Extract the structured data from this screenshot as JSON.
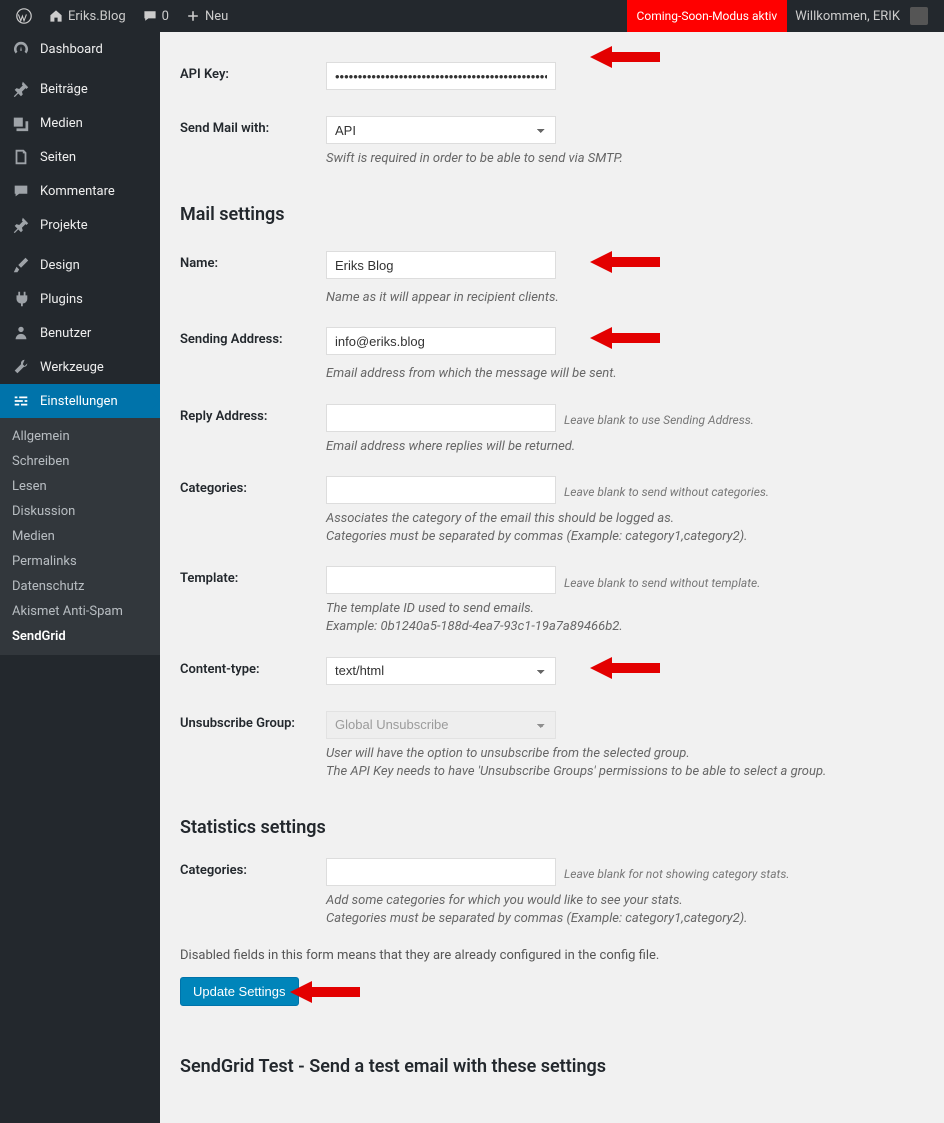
{
  "topbar": {
    "site_name": "Eriks.Blog",
    "comments_count": "0",
    "new_label": "Neu",
    "coming_soon": "Coming-Soon-Modus aktiv",
    "welcome": "Willkommen, ERIK"
  },
  "sidebar": {
    "items": [
      {
        "label": "Dashboard",
        "icon": "dashboard"
      },
      {
        "label": "Beiträge",
        "icon": "post"
      },
      {
        "label": "Medien",
        "icon": "media"
      },
      {
        "label": "Seiten",
        "icon": "page"
      },
      {
        "label": "Kommentare",
        "icon": "comment"
      },
      {
        "label": "Projekte",
        "icon": "project"
      },
      {
        "label": "Design",
        "icon": "design"
      },
      {
        "label": "Plugins",
        "icon": "plugin"
      },
      {
        "label": "Benutzer",
        "icon": "user"
      },
      {
        "label": "Werkzeuge",
        "icon": "tool"
      },
      {
        "label": "Einstellungen",
        "icon": "settings"
      }
    ],
    "submenu": [
      "Allgemein",
      "Schreiben",
      "Lesen",
      "Diskussion",
      "Medien",
      "Permalinks",
      "Datenschutz",
      "Akismet Anti-Spam",
      "SendGrid"
    ]
  },
  "form": {
    "api_key": {
      "label": "API Key:",
      "value": "••••••••••••••••••••••••••••••••••••••••••••••••••••"
    },
    "send_mail": {
      "label": "Send Mail with:",
      "value": "API",
      "desc": "Swift is required in order to be able to send via SMTP."
    },
    "mail_settings_heading": "Mail settings",
    "name": {
      "label": "Name:",
      "value": "Eriks Blog",
      "desc": "Name as it will appear in recipient clients."
    },
    "sending_address": {
      "label": "Sending Address:",
      "value": "info@eriks.blog",
      "desc": "Email address from which the message will be sent."
    },
    "reply_address": {
      "label": "Reply Address:",
      "value": "",
      "hint": "Leave blank to use Sending Address.",
      "desc": "Email address where replies will be returned."
    },
    "categories": {
      "label": "Categories:",
      "value": "",
      "hint": "Leave blank to send without categories.",
      "desc1": "Associates the category of the email this should be logged as.",
      "desc2": "Categories must be separated by commas (Example: category1,category2)."
    },
    "template": {
      "label": "Template:",
      "value": "",
      "hint": "Leave blank to send without template.",
      "desc1": "The template ID used to send emails.",
      "desc2": "Example: 0b1240a5-188d-4ea7-93c1-19a7a89466b2."
    },
    "content_type": {
      "label": "Content-type:",
      "value": "text/html"
    },
    "unsubscribe": {
      "label": "Unsubscribe Group:",
      "value": "Global Unsubscribe",
      "desc1": "User will have the option to unsubscribe from the selected group.",
      "desc2": "The API Key needs to have 'Unsubscribe Groups' permissions to be able to select a group."
    },
    "stats_heading": "Statistics settings",
    "stats_categories": {
      "label": "Categories:",
      "value": "",
      "hint": "Leave blank for not showing category stats.",
      "desc1": "Add some categories for which you would like to see your stats.",
      "desc2": "Categories must be separated by commas (Example: category1,category2)."
    },
    "disabled_note": "Disabled fields in this form means that they are already configured in the config file.",
    "update_button": "Update Settings",
    "test_heading": "SendGrid Test - Send a test email with these settings"
  }
}
